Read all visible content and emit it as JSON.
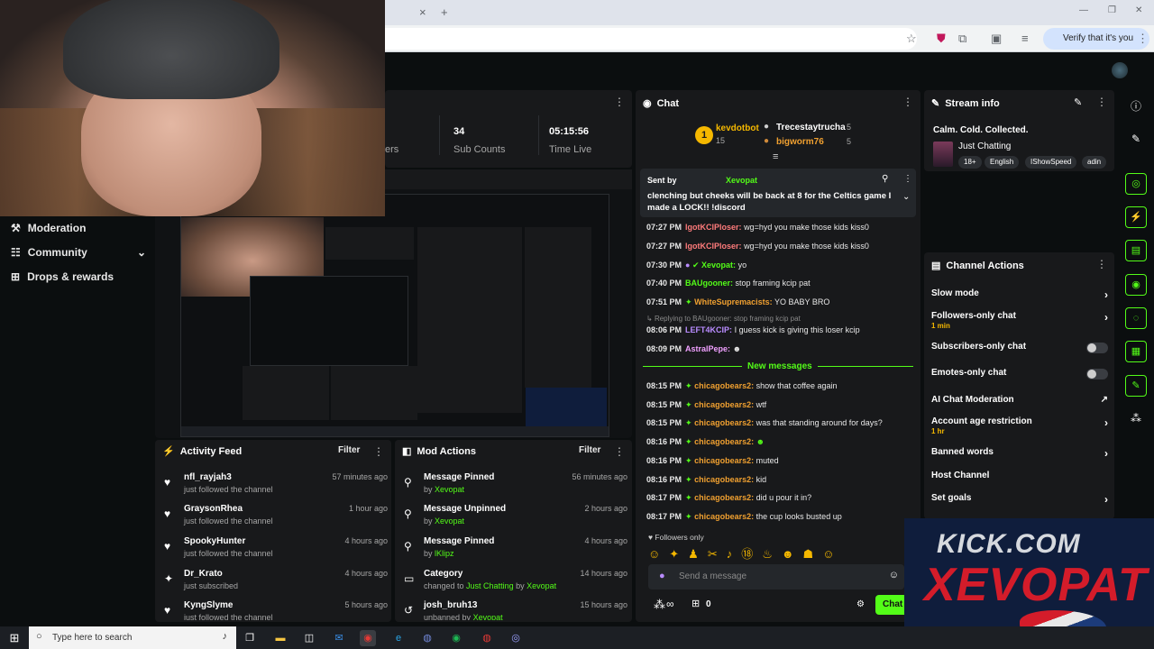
{
  "browser": {
    "close_tab": "×",
    "new_tab": "+",
    "window_controls": [
      "—",
      "❐",
      "✕"
    ],
    "profile_chip": "Verify that it's you"
  },
  "left_nav": {
    "items": [
      {
        "label": "Moderation",
        "icon": "gavel-icon"
      },
      {
        "label": "Community",
        "icon": "people-icon"
      },
      {
        "label": "Drops & rewards",
        "icon": "gift-icon"
      }
    ]
  },
  "stats": {
    "partial_label": "ers",
    "sub_counts_value": "34",
    "sub_counts_label": "Sub Counts",
    "time_live_value": "05:15:56",
    "time_live_label": "Time Live"
  },
  "activity_feed": {
    "title": "Activity Feed",
    "filter": "Filter",
    "items": [
      {
        "name": "nfl_rayjah3",
        "sub": "just followed the channel",
        "time": "57 minutes ago",
        "icon": "heart-icon"
      },
      {
        "name": "GraysonRhea",
        "sub": "just followed the channel",
        "time": "1 hour ago",
        "icon": "heart-icon"
      },
      {
        "name": "SpookyHunter",
        "sub": "just followed the channel",
        "time": "4 hours ago",
        "icon": "heart-icon"
      },
      {
        "name": "Dr_Krato",
        "sub": "just subscribed",
        "time": "4 hours ago",
        "icon": "star-icon"
      },
      {
        "name": "KyngSlyme",
        "sub": "just followed the channel",
        "time": "5 hours ago",
        "icon": "heart-icon"
      }
    ]
  },
  "mod_actions": {
    "title": "Mod Actions",
    "filter": "Filter",
    "items": [
      {
        "name": "Message Pinned",
        "sub_prefix": "by ",
        "sub_user": "Xevopat",
        "time": "56 minutes ago"
      },
      {
        "name": "Message Unpinned",
        "sub_prefix": "by ",
        "sub_user": "Xevopat",
        "time": "2 hours ago"
      },
      {
        "name": "Message Pinned",
        "sub_prefix": "by ",
        "sub_user": "lKlipz",
        "time": "4 hours ago"
      },
      {
        "name": "Category",
        "sub_prefix": "changed to ",
        "sub_user": "Just Chatting",
        "sub_by": " by ",
        "sub_user2": "Xevopat",
        "time": "14 hours ago"
      },
      {
        "name": "josh_bruh13",
        "sub_prefix": "unbanned by ",
        "sub_user": "Xevopat",
        "time": "15 hours ago"
      }
    ]
  },
  "chat": {
    "title": "Chat",
    "leaderboard": {
      "rank1_badge": "1",
      "rank1_name": "kevdotbot",
      "rank1_count": "15",
      "second_name": "Trecestaytrucha",
      "second_count": "5",
      "third_name": "bigworm76",
      "third_count": "5"
    },
    "pinned": {
      "sent_by": "Sent by",
      "user": "Xevopat",
      "text": "clenching but cheeks will be back at 8 for the Celtics game I made a LOCK!! !discord"
    },
    "messages": [
      {
        "time": "07:27 PM",
        "user": "lgotKClPloser:",
        "text": "wg=hyd you make those kids kiss0",
        "color": "#ff7b7b"
      },
      {
        "time": "07:27 PM",
        "user": "lgotKClPloser:",
        "text": "wg=hyd you make those kids kiss0",
        "color": "#ff7b7b"
      },
      {
        "time": "07:30 PM",
        "user": "Xevopat:",
        "text": "yo",
        "color": "#53fc18"
      },
      {
        "time": "07:40 PM",
        "user": "BAUgooner:",
        "text": "stop framing kcip pat",
        "color": "#53fc18"
      },
      {
        "time": "07:51 PM",
        "user": "WhiteSupremacists:",
        "text": "YO BABY BRO",
        "color": "#f0a030"
      },
      {
        "time": "08:06 PM",
        "user": "LEFT4KCIP:",
        "text": "I guess kick is giving this loser kcip",
        "color": "#b98cff"
      },
      {
        "time": "08:09 PM",
        "user": "AstralPepe:",
        "text": "",
        "color": "#f0a0ff"
      },
      {
        "time": "08:15 PM",
        "user": "chicagobears2:",
        "text": "show that coffee again",
        "color": "#f0a030"
      },
      {
        "time": "08:15 PM",
        "user": "chicagobears2:",
        "text": "wtf",
        "color": "#f0a030"
      },
      {
        "time": "08:15 PM",
        "user": "chicagobears2:",
        "text": "was that standing around for days?",
        "color": "#f0a030"
      },
      {
        "time": "08:16 PM",
        "user": "chicagobears2:",
        "text": "",
        "color": "#f0a030"
      },
      {
        "time": "08:16 PM",
        "user": "chicagobears2:",
        "text": "muted",
        "color": "#f0a030"
      },
      {
        "time": "08:16 PM",
        "user": "chicagobears2:",
        "text": "kid",
        "color": "#f0a030"
      },
      {
        "time": "08:17 PM",
        "user": "chicagobears2:",
        "text": "did u pour it in?",
        "color": "#f0a030"
      },
      {
        "time": "08:17 PM",
        "user": "chicagobears2:",
        "text": "the cup looks busted up",
        "color": "#f0a030"
      }
    ],
    "reply_note": "Replying to BAUgooner: stop framing kcip pat",
    "new_messages": "New messages",
    "followers_only": "Followers only",
    "send_placeholder": "Send a message",
    "infinity": "∞",
    "gift_count": "0",
    "chat_button": "Chat"
  },
  "stream_info": {
    "title": "Stream info",
    "stream_title": "Calm. Cold. Collected.",
    "category": "Just Chatting",
    "tags": [
      "18+",
      "English",
      "IShowSpeed",
      "adin"
    ]
  },
  "channel_actions": {
    "title": "Channel Actions",
    "items": [
      {
        "label": "Slow mode",
        "sub": "",
        "control": "chevron"
      },
      {
        "label": "Followers-only chat",
        "sub": "1 min",
        "control": "chevron"
      },
      {
        "label": "Subscribers-only chat",
        "sub": "",
        "control": "toggle"
      },
      {
        "label": "Emotes-only chat",
        "sub": "",
        "control": "toggle"
      },
      {
        "label": "AI Chat Moderation",
        "sub": "",
        "control": "external"
      },
      {
        "label": "Account age restriction",
        "sub": "1 hr",
        "control": "chevron"
      },
      {
        "label": "Banned words",
        "sub": "",
        "control": "chevron"
      },
      {
        "label": "Host Channel",
        "sub": "",
        "control": "none"
      },
      {
        "label": "Set goals",
        "sub": "",
        "control": "chevron"
      }
    ]
  },
  "overlay_logo": {
    "line1": "KICK.COM",
    "line2": "XEVOPAT"
  },
  "taskbar": {
    "search_placeholder": "Type here to search"
  },
  "colors": {
    "accent": "#53fc18",
    "panel": "#18191b",
    "background": "#0b0e0f"
  }
}
